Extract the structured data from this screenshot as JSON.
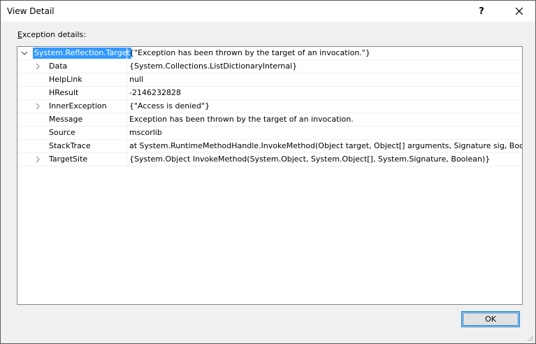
{
  "window": {
    "title": "View Detail",
    "help_label": "?",
    "close_icon": "close-icon"
  },
  "label": {
    "accelerator": "E",
    "rest": "xception details:"
  },
  "grid": {
    "root": {
      "name": "System.Reflection.Target",
      "value": "{\"Exception has been thrown by the target of an invocation.\"}",
      "expanded": true
    },
    "rows": [
      {
        "name": "Data",
        "value": "{System.Collections.ListDictionaryInternal}",
        "expandable": true
      },
      {
        "name": "HelpLink",
        "value": "null",
        "expandable": false
      },
      {
        "name": "HResult",
        "value": "-2146232828",
        "expandable": false
      },
      {
        "name": "InnerException",
        "value": "{\"Access is denied\"}",
        "expandable": true
      },
      {
        "name": "Message",
        "value": "Exception has been thrown by the target of an invocation.",
        "expandable": false
      },
      {
        "name": "Source",
        "value": "mscorlib",
        "expandable": false
      },
      {
        "name": "StackTrace",
        "value": "   at System.RuntimeMethodHandle.InvokeMethod(Object target, Object[] arguments, Signature sig, Boolea",
        "expandable": false
      },
      {
        "name": "TargetSite",
        "value": "{System.Object InvokeMethod(System.Object, System.Object[], System.Signature, Boolean)}",
        "expandable": true
      }
    ]
  },
  "footer": {
    "ok_label": "OK"
  },
  "colors": {
    "selection": "#3399ff",
    "accent_border": "#0078d7",
    "dialog_bg": "#f0f0f0"
  }
}
